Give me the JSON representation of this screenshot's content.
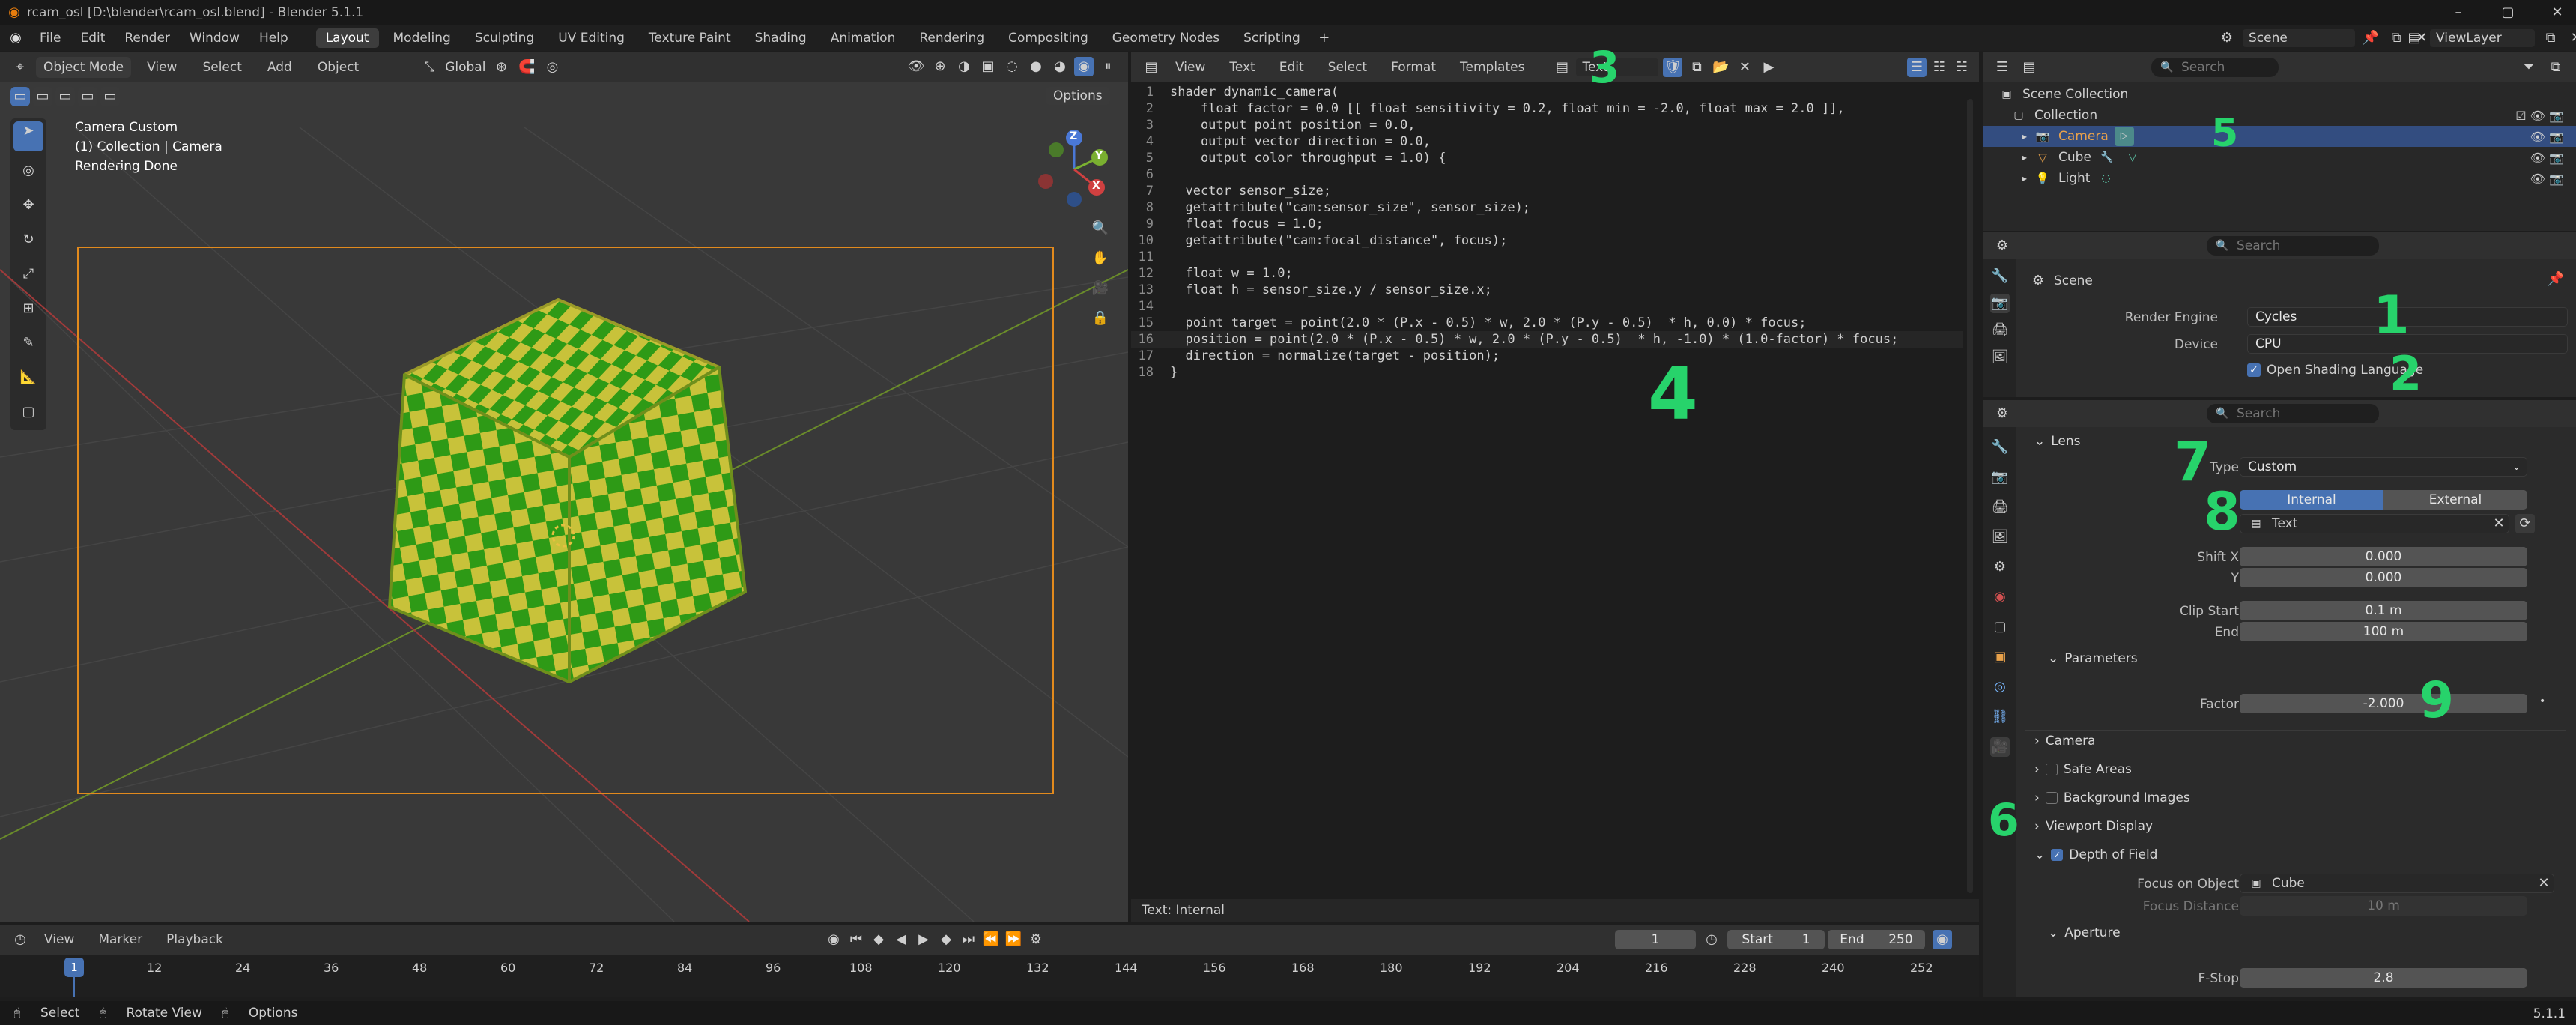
{
  "window": {
    "title": "rcam_osl [D:\\blender\\rcam_osl.blend] - Blender 5.1.1"
  },
  "menu": [
    "File",
    "Edit",
    "Render",
    "Window",
    "Help"
  ],
  "workspaces": [
    "Layout",
    "Modeling",
    "Sculpting",
    "UV Editing",
    "Texture Paint",
    "Shading",
    "Animation",
    "Rendering",
    "Compositing",
    "Geometry Nodes",
    "Scripting"
  ],
  "scene": {
    "name": "Scene",
    "view_layer": "ViewLayer"
  },
  "viewport": {
    "mode": "Object Mode",
    "menus": [
      "View",
      "Select",
      "Add",
      "Object"
    ],
    "transform": "Global",
    "options": "Options",
    "info_line1": "Camera Custom",
    "info_line2": "(1) Collection | Camera",
    "info_line3": "Rendering Done",
    "axis_x": "X",
    "axis_y": "Y",
    "axis_z": "Z"
  },
  "text_editor": {
    "menus": [
      "View",
      "Text",
      "Edit",
      "Select",
      "Format",
      "Templates"
    ],
    "datablock": "Text",
    "footer": "Text: Internal",
    "lines": [
      "shader dynamic_camera(",
      "    float factor = 0.0 [[ float sensitivity = 0.2, float min = -2.0, float max = 2.0 ]],",
      "    output point position = 0.0,",
      "    output vector direction = 0.0,",
      "    output color throughput = 1.0) {",
      "",
      "  vector sensor_size;",
      "  getattribute(\"cam:sensor_size\", sensor_size);",
      "  float focus = 1.0;",
      "  getattribute(\"cam:focal_distance\", focus);",
      "",
      "  float w = 1.0;",
      "  float h = sensor_size.y / sensor_size.x;",
      "",
      "  point target = point(2.0 * (P.x - 0.5) * w, 2.0 * (P.y - 0.5)  * h, 0.0) * focus;",
      "  position = point(2.0 * (P.x - 0.5) * w, 2.0 * (P.y - 0.5)  * h, -1.0) * (1.0-factor) * focus;",
      "  direction = normalize(target - position);",
      "}"
    ]
  },
  "outliner": {
    "search_placeholder": "Search",
    "root": "Scene Collection",
    "collection": "Collection",
    "items": [
      "Camera",
      "Cube",
      "Light"
    ]
  },
  "render_props": {
    "search_placeholder": "Search",
    "context": "Scene",
    "render_engine_label": "Render Engine",
    "render_engine": "Cycles",
    "device_label": "Device",
    "device": "CPU",
    "osl_label": "Open Shading Language"
  },
  "camera_props": {
    "search_placeholder": "Search",
    "lens_label": "Lens",
    "type_label": "Type",
    "type_value": "Custom",
    "internal": "Internal",
    "external": "External",
    "script": "Text",
    "shift_x_label": "Shift X",
    "shift_x": "0.000",
    "shift_y_label": "Y",
    "shift_y": "0.000",
    "clip_start_label": "Clip Start",
    "clip_start": "0.1 m",
    "clip_end_label": "End",
    "clip_end": "100 m",
    "parameters_label": "Parameters",
    "factor_label": "Factor",
    "factor": "-2.000",
    "camera_label": "Camera",
    "safe_areas_label": "Safe Areas",
    "bg_images_label": "Background Images",
    "viewport_display_label": "Viewport Display",
    "dof_label": "Depth of Field",
    "focus_object_label": "Focus on Object",
    "focus_object": "Cube",
    "focus_distance_label": "Focus Distance",
    "focus_distance": "10 m",
    "aperture_label": "Aperture",
    "fstop_label": "F-Stop",
    "fstop": "2.8"
  },
  "timeline": {
    "menus": [
      "View",
      "Marker",
      "Playback"
    ],
    "current_frame": "1",
    "start_label": "Start",
    "start": "1",
    "end_label": "End",
    "end": "250",
    "ticks": [
      "1",
      "12",
      "24",
      "36",
      "48",
      "60",
      "72",
      "84",
      "96",
      "108",
      "120",
      "132",
      "144",
      "156",
      "168",
      "180",
      "192",
      "204",
      "216",
      "228",
      "240",
      "252"
    ]
  },
  "statusbar": {
    "select": "Select",
    "rotate": "Rotate View",
    "options": "Options",
    "version": "5.1.1"
  },
  "annotations": [
    "1",
    "2",
    "3",
    "4",
    "5",
    "6",
    "7",
    "8",
    "9"
  ],
  "colors": {
    "accent": "#4772b3",
    "annotation": "#27d36b",
    "cube_a": "#2e9a16",
    "cube_b": "#c8c23a"
  }
}
